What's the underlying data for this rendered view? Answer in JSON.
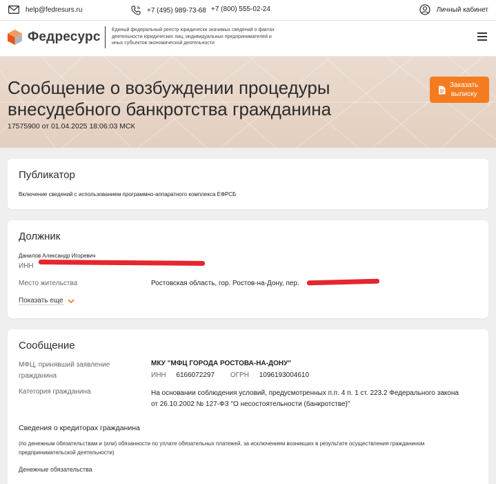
{
  "topbar": {
    "email": "help@fedresurs.ru",
    "phone1": "+7 (495) 989-73-68",
    "phone2": "+7 (800) 555-02-24",
    "cabinet": "Личный кабинет"
  },
  "header": {
    "logo_text": "Федресурс",
    "description": "Единый федеральный реестр юридически значимых сведений о фактах деятельности юридических лиц, индивидуальных предпринимателей и иных субъектов экономической деятельности"
  },
  "hero": {
    "title_line1": "Сообщение о возбуждении процедуры",
    "title_line2": "внесудебного банкротства гражданина",
    "meta": "17575900 от 01.04.2025 18:06:03 МСК",
    "order_button_line1": "Заказать",
    "order_button_line2": "выписку"
  },
  "publisher": {
    "title": "Публикатор",
    "text": "Включение сведений с использованием программно-аппаратного комплекса ЕФРСБ"
  },
  "debtor": {
    "title": "Должник",
    "name": "Данилов Александр Игоревич",
    "inn_label": "ИНН",
    "residence_label": "Место жительства",
    "residence_value": "Ростовская область, гор. Ростов-на-Дону, пер.",
    "show_more": "Показать еще"
  },
  "message": {
    "title": "Сообщение",
    "mfc_label_line1": "МФЦ, принявший заявление",
    "mfc_label_line2": "гражданина",
    "mfc_name": "МКУ \"МФЦ ГОРОДА РОСТОВА-НА-ДОНУ\"",
    "inn_label": "ИНН",
    "inn_value": "6166072297",
    "ogrn_label": "ОГРН",
    "ogrn_value": "1096193004610",
    "category_label": "Категория гражданина",
    "category_value_line1": "На основании соблюдения условий, предусмотренных п.п. 4 п. 1 ст. 223.2 Федерального закона",
    "category_value_line2": "от 26.10.2002 № 127-ФЗ \"О несостоятельности (банкротстве)\"",
    "creditors_title": "Сведения о кредиторах гражданина",
    "creditors_note_line1": "(по денежным обязательствам и (или) обязанности по уплате обязательных платежей, за исключением возникших в результате осуществления гражданином",
    "creditors_note_line2": "предпринимательской деятельности)",
    "monetary": "Денежные обязательства"
  },
  "colors": {
    "accent": "#f47b20",
    "redaction": "#e5262d",
    "hero_bg": "#e6d3c5"
  }
}
